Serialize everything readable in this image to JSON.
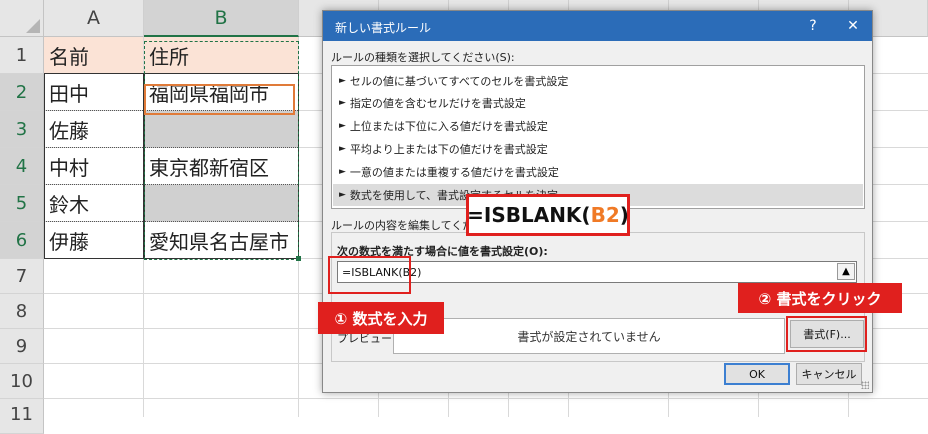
{
  "sheet": {
    "columns": [
      "A",
      "B",
      "",
      "",
      "",
      "",
      "",
      "",
      "",
      ""
    ],
    "rows": [
      "1",
      "2",
      "3",
      "4",
      "5",
      "6",
      "7",
      "8",
      "9",
      "10",
      "11"
    ],
    "cells": {
      "A1": "名前",
      "B1": "住所",
      "A2": "田中",
      "B2": "福岡県福岡市",
      "A3": "佐藤",
      "B3": "",
      "A4": "中村",
      "B4": "東京都新宿区",
      "A5": "鈴木",
      "B5": "",
      "A6": "伊藤",
      "B6": "愛知県名古屋市"
    },
    "colors": {
      "header_fill": "#fbe3d6",
      "blank_fill": "#d0d0d0",
      "accent": "#217346"
    }
  },
  "dialog": {
    "title": "新しい書式ルール",
    "help_label": "?",
    "close_label": "✕",
    "rule_type_label": "ルールの種類を選択してください(S):",
    "rule_types": [
      "セルの値に基づいてすべてのセルを書式設定",
      "指定の値を含むセルだけを書式設定",
      "上位または下位に入る値だけを書式設定",
      "平均より上または下の値だけを書式設定",
      "一意の値または重複する値だけを書式設定",
      "数式を使用して、書式設定するセルを決定"
    ],
    "selected_rule_index": 5,
    "edit_label": "ルールの内容を編集してください(E):",
    "formula_label": "次の数式を満たす場合に値を書式設定(O):",
    "formula_value": "=ISBLANK(B2)",
    "collapse_icon": "▲",
    "preview_label": "プレビュー:",
    "preview_text": "書式が設定されていません",
    "format_button": "書式(F)...",
    "ok_button": "OK",
    "cancel_button": "キャンセル",
    "colors": {
      "titlebar": "#2b6cb8"
    }
  },
  "annotations": {
    "formula_prefix": "=ISBLANK(",
    "formula_highlight": "B2",
    "formula_suffix": ")",
    "step1": "① 数式を入力",
    "step2": "② 書式をクリック",
    "colors": {
      "red": "#e0201e",
      "orange": "#f07a26"
    }
  }
}
